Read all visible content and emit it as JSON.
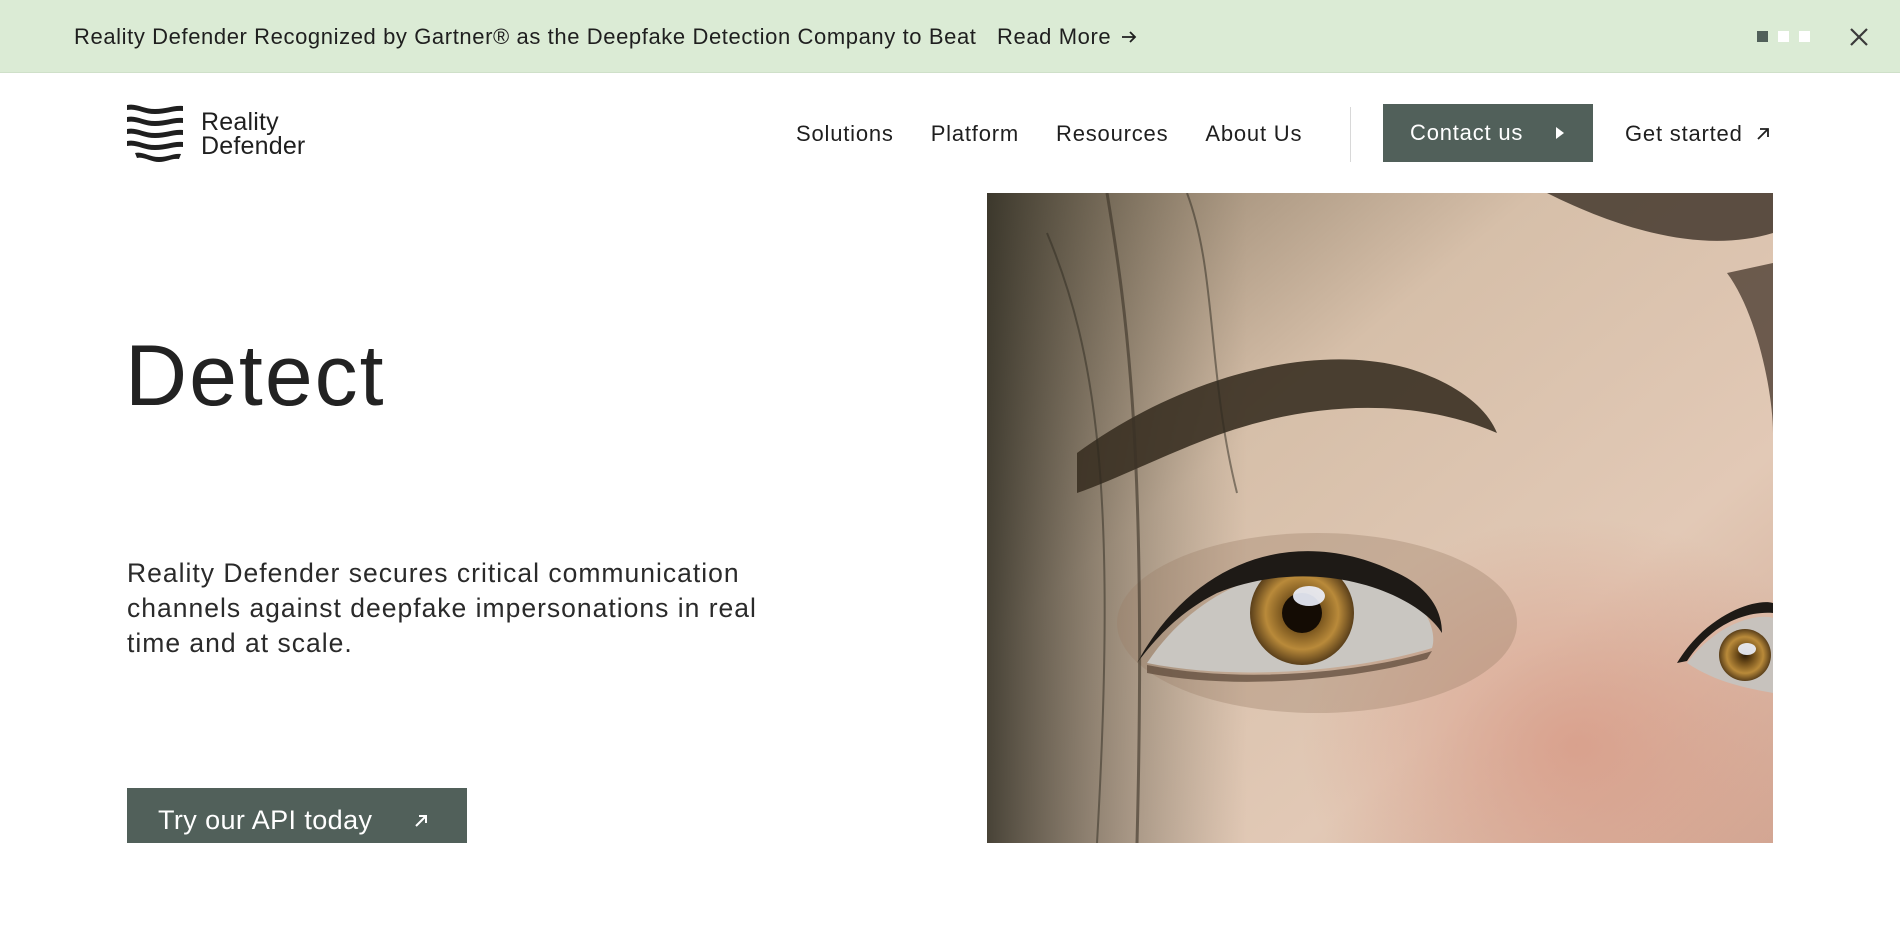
{
  "banner": {
    "text": "Reality Defender Recognized by Gartner® as the Deepfake Detection Company to Beat",
    "link_label": "Read More",
    "link_icon": "arrow-right-icon",
    "slides": 3,
    "active_slide": 1,
    "close_icon": "close-icon"
  },
  "header": {
    "logo_line1": "Reality",
    "logo_line2": "Defender",
    "nav": [
      {
        "label": "Solutions"
      },
      {
        "label": "Platform"
      },
      {
        "label": "Resources"
      },
      {
        "label": "About Us"
      }
    ],
    "contact_label": "Contact us",
    "contact_icon": "caret-right-icon",
    "get_started_label": "Get started",
    "get_started_icon": "arrow-up-right-icon"
  },
  "hero": {
    "title": "Detect",
    "description": "Reality Defender secures critical communication channels against deepfake impersonations in real time and at scale.",
    "cta_label": "Try our API today",
    "cta_icon": "arrow-up-right-icon",
    "image": "close-up-eye-photo"
  },
  "colors": {
    "banner_bg": "#dbebd5",
    "button_bg": "#51605a",
    "text": "#1f1f1f"
  }
}
